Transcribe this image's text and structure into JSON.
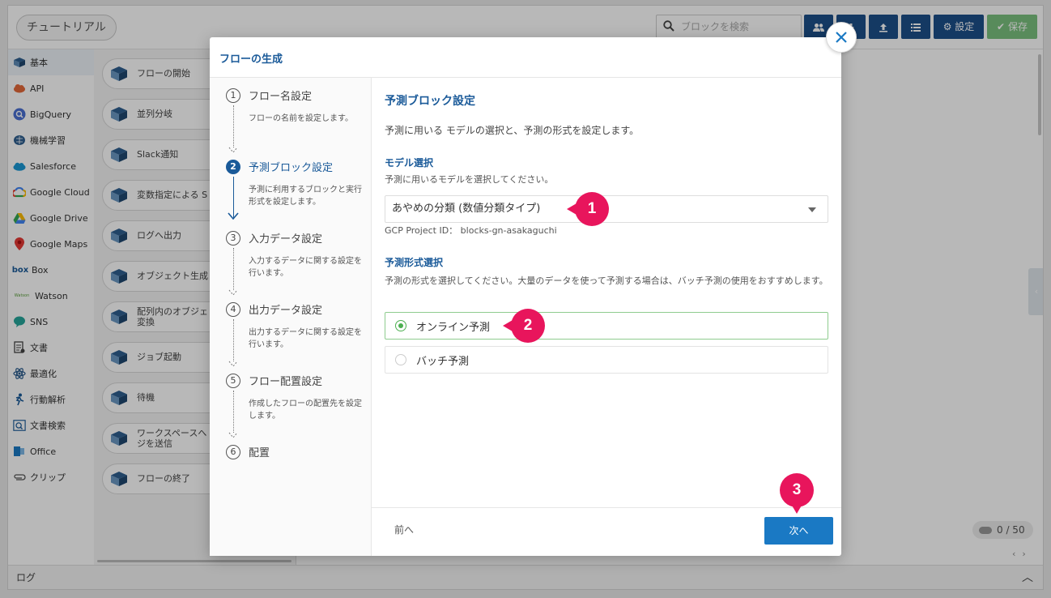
{
  "app": {
    "tutorial_label": "チュートリアル",
    "search_placeholder": "ブロックを検索",
    "settings_label": "設定",
    "save_label": "保存",
    "log_label": "ログ",
    "counter": "0 / 50"
  },
  "sidebar": {
    "items": [
      {
        "label": "基本",
        "icon": "cube-icon"
      },
      {
        "label": "API",
        "icon": "api-cloud-icon"
      },
      {
        "label": "BigQuery",
        "icon": "bigquery-icon"
      },
      {
        "label": "機械学習",
        "icon": "brain-icon"
      },
      {
        "label": "Salesforce",
        "icon": "salesforce-cloud-icon"
      },
      {
        "label": "Google Cloud",
        "icon": "google-cloud-icon"
      },
      {
        "label": "Google Drive",
        "icon": "google-drive-icon"
      },
      {
        "label": "Google Maps",
        "icon": "map-pin-icon"
      },
      {
        "label": "Box",
        "icon": "box-logo-icon"
      },
      {
        "label": "Watson",
        "icon": "watson-logo-icon"
      },
      {
        "label": "SNS",
        "icon": "chat-bubble-icon"
      },
      {
        "label": "文書",
        "icon": "document-icon"
      },
      {
        "label": "最適化",
        "icon": "atom-icon"
      },
      {
        "label": "行動解析",
        "icon": "running-person-icon"
      },
      {
        "label": "文書検索",
        "icon": "document-search-icon"
      },
      {
        "label": "Office",
        "icon": "office-icon"
      },
      {
        "label": "クリップ",
        "icon": "paperclip-icon"
      }
    ],
    "icon_texts": {
      "box": "box",
      "watson": "Watson"
    }
  },
  "blocks": {
    "items": [
      {
        "label": "フローの開始"
      },
      {
        "label": "並列分岐"
      },
      {
        "label": "Slack通知"
      },
      {
        "label": "変数指定による S"
      },
      {
        "label": "ログへ出力"
      },
      {
        "label": "オブジェクト生成"
      },
      {
        "label": "配列内のオブジェ 変換"
      },
      {
        "label": "ジョブ起動"
      },
      {
        "label": "待機"
      },
      {
        "label": "ワークスペースへ ジを送信"
      },
      {
        "label": "フローの終了"
      }
    ]
  },
  "modal": {
    "title": "フローの生成",
    "steps": [
      {
        "num": "1",
        "title": "フロー名設定",
        "desc": "フローの名前を設定します。"
      },
      {
        "num": "2",
        "title": "予測ブロック設定",
        "desc": "予測に利用するブロックと実行形式を設定します。"
      },
      {
        "num": "3",
        "title": "入力データ設定",
        "desc": "入力するデータに関する設定を行います。"
      },
      {
        "num": "4",
        "title": "出力データ設定",
        "desc": "出力するデータに関する設定を行います。"
      },
      {
        "num": "5",
        "title": "フロー配置設定",
        "desc": "作成したフローの配置先を設定します。"
      },
      {
        "num": "6",
        "title": "配置",
        "desc": ""
      }
    ],
    "content": {
      "heading": "予測ブロック設定",
      "intro": "予測に用いる モデルの選択と、予測の形式を設定します。",
      "model_label": "モデル選択",
      "model_hint": "予測に用いるモデルを選択してください。",
      "model_value": "あやめの分類 (数値分類タイプ)",
      "project_id": "GCP Project ID： blocks-gn-asakaguchi",
      "format_label": "予測形式選択",
      "format_hint": "予測の形式を選択してください。大量のデータを使って予測する場合は、バッチ予測の使用をおすすめします。",
      "options": [
        {
          "label": "オンライン予測",
          "selected": true
        },
        {
          "label": "バッチ予測",
          "selected": false
        }
      ]
    },
    "footer": {
      "prev": "前へ",
      "next": "次へ"
    }
  },
  "callouts": [
    "1",
    "2",
    "3"
  ],
  "colors": {
    "brand": "#1a5a99",
    "accent": "#e8155c",
    "primary_button": "#1a79c4",
    "radio_selected": "#4caf50"
  }
}
